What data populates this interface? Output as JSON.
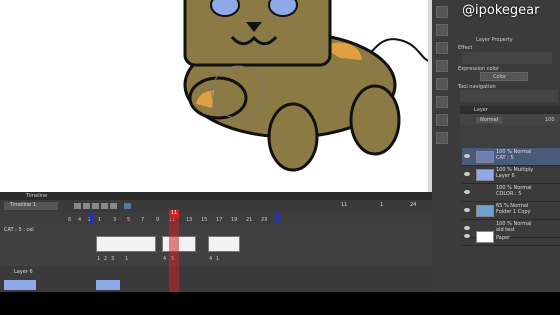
{
  "watermark": "@ipokegear",
  "right_panel": {
    "layer_property_title": "Layer Property",
    "effect_label": "Effect",
    "expression_color_label": "Expression color",
    "expression_color_value": "Color",
    "tool_navigation_label": "Tool navigation",
    "layer_tab": "Layer",
    "blend_mode": "Normal",
    "opacity_value": "100",
    "layers": [
      {
        "line1": "100 % Normal",
        "line2": "CAT : 5"
      },
      {
        "line1": "100 % Multiply",
        "line2": "Layer 6"
      },
      {
        "line1": "100 % Normal",
        "line2": "COLOR : 5"
      },
      {
        "line1": "65 % Normal",
        "line2": "Folder 1 Copy"
      },
      {
        "line1": "100 % Normal",
        "line2": "old test"
      },
      {
        "line1": "",
        "line2": "Paper"
      }
    ]
  },
  "timeline": {
    "title": "Timeline",
    "timeline_name": "Timeline 1",
    "current_frame": "11",
    "frame_info_a": "11",
    "frame_info_b": "1",
    "frame_info_c": "24",
    "ruler_ticks": [
      "1",
      "3",
      "5",
      "7",
      "9",
      "11",
      "13",
      "15",
      "17",
      "19",
      "21",
      "23"
    ],
    "ruler_ticks_left": [
      "6",
      "4",
      "2"
    ],
    "track1_label": "CAT : 5 : cel",
    "track1_numbers": [
      "1",
      "2",
      "3",
      "1",
      "4",
      "5",
      "4",
      "1"
    ],
    "track2_label": "Layer 6"
  },
  "colors": {
    "cat_body": "#8c7a45",
    "cat_outline": "#111111",
    "cat_eyes": "#8fa8e8",
    "cat_accent": "#e0a040",
    "playhead": "#cc2222",
    "range_marker": "#2233bb"
  }
}
